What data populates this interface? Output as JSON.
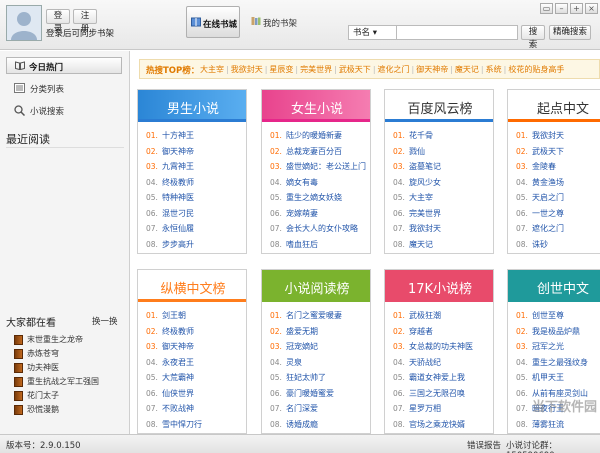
{
  "header": {
    "login_label": "登录",
    "register_label": "注册",
    "login_tip": "登录后可同步书架",
    "tab_online": "在线书城",
    "tab_shelf": "我的书架",
    "search_type": "书名 ▾",
    "search_placeholder": "",
    "search_button": "搜索",
    "exact_search_button": "精确搜索",
    "window_buttons": [
      "▭",
      "–",
      "+",
      "×"
    ]
  },
  "sidebar": {
    "nav_hot": "今日热门",
    "nav_category": "分类列表",
    "nav_search": "小说搜索",
    "recent_title": "最近阅读",
    "watching_title": "大家都在看",
    "watching_switch": "换一换",
    "watching": [
      "末世重生之龙帝",
      "赤炼苍穹",
      "功夫神医",
      "重生抗战之军工强国",
      "花门太子",
      "恐慌漫鹅"
    ]
  },
  "hotbar": {
    "label": "热搜TOP榜：",
    "items": [
      "大主宰",
      "我欲封天",
      "星辰变",
      "完美世界",
      "武极天下",
      "遮化之门",
      "御天神帝",
      "魔天记",
      "系统",
      "校花的贴身高手"
    ]
  },
  "cards": [
    {
      "title": "男生小说",
      "items": [
        "十方神王",
        "御天神帝",
        "九霄神王",
        "终极教师",
        "特种神医",
        "混世刁民",
        "永恒仙履",
        "步步高升"
      ]
    },
    {
      "title": "女生小说",
      "items": [
        "陆少的暖婚新妻",
        "总裁宠妻百分百",
        "盛世嫡妃：老公送上门",
        "嫡女有毒",
        "重生之嫡女妖娆",
        "宠嫁萌妻",
        "会长大人的女仆攻略",
        "嗜血狂后"
      ]
    },
    {
      "title": "百度风云榜",
      "items": [
        "花千骨",
        "戮仙",
        "盗墓笔记",
        "旋风少女",
        "大主宰",
        "完美世界",
        "我欲封天",
        "魔天记"
      ]
    },
    {
      "title": "起点中文",
      "items": [
        "我欲封天",
        "武极天下",
        "金陵春",
        "黄金渔场",
        "天启之门",
        "一世之尊",
        "遮化之门",
        "诛砂"
      ]
    },
    {
      "title": "纵横中文榜",
      "items": [
        "剑王朝",
        "终极教师",
        "御天神帝",
        "永夜君王",
        "大荒霸神",
        "仙侠世界",
        "不败战神",
        "雪中悍刀行"
      ]
    },
    {
      "title": "小说阅读榜",
      "items": [
        "名门之蜜爱暖妻",
        "盛爱无期",
        "冠宠嫡妃",
        "灵泉",
        "狂妃太帅了",
        "豪门暖婚蜜爱",
        "名门深爱",
        "诱婚成瘾"
      ]
    },
    {
      "title": "17K小说榜",
      "items": [
        "武极狂潮",
        "穿越者",
        "女总裁的功夫神医",
        "天骄战纪",
        "霸道女神爱上我",
        "三国之无限召唤",
        "星罗万相",
        "官场之乘龙快婿"
      ]
    },
    {
      "title": "创世中文",
      "items": [
        "创世至尊",
        "我是极品炉鼎",
        "冠军之光",
        "重生之最强纹身",
        "机甲天王",
        "从前有座灵剑山",
        "暗夜行王",
        "薄雾狂流"
      ]
    }
  ],
  "status": {
    "version": "版本号：2.9.0.150",
    "report": "错误报告",
    "forum": "小说讨论群：150590690",
    "watermark": "当下软件园"
  },
  "colors": {
    "accent": "#e07a00",
    "link": "#2255aa",
    "rank": "#ff6a00"
  }
}
